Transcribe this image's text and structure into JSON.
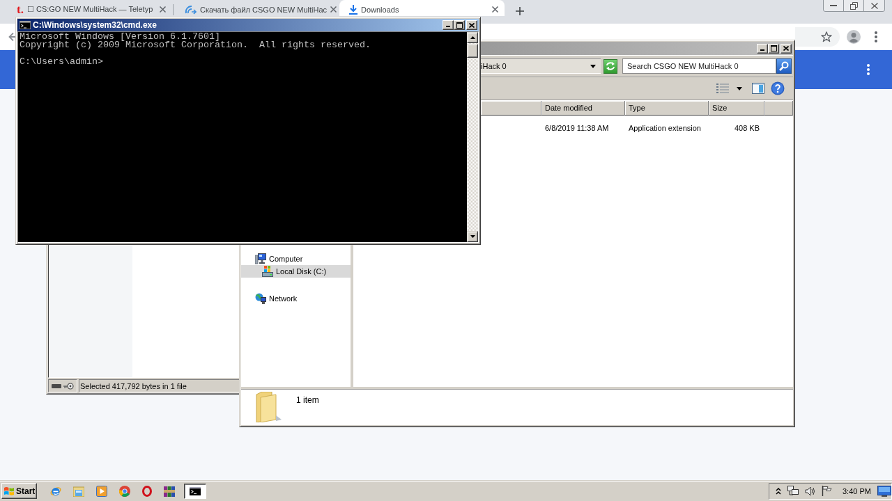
{
  "browser": {
    "tabs": [
      {
        "kind": "letter",
        "favicon_text": "t.",
        "title": "☐ CS:GO NEW MultiHack — Teletyp",
        "selected": false
      },
      {
        "kind": "arcs",
        "title": "Скачать файл CSGO NEW MultiHac",
        "selected": false
      },
      {
        "kind": "download",
        "title": "Downloads",
        "selected": true
      }
    ]
  },
  "back_window": {
    "status_text": "Selected 417,792 bytes in 1 file"
  },
  "explorer_window": {
    "active": false,
    "address": "iHack 0",
    "search": {
      "placeholder": "Search CSGO NEW MultiHack 0"
    },
    "nav": [
      {
        "kind": "computer",
        "label": "Computer",
        "selected": false,
        "children": [
          {
            "kind": "disk",
            "label": "Local Disk (C:)",
            "selected": true
          }
        ]
      },
      {
        "kind": "network",
        "label": "Network",
        "selected": false
      }
    ],
    "columns": [
      {
        "label": "Date modified"
      },
      {
        "label": "Type"
      },
      {
        "label": "Size"
      }
    ],
    "rows": [
      {
        "cells": [
          "6/8/2019 11:38 AM",
          "Application extension",
          "408 KB"
        ]
      }
    ],
    "details": {
      "summary": "1 item"
    }
  },
  "cmd_window": {
    "title": "C:\\Windows\\system32\\cmd.exe",
    "active": true,
    "output": [
      "Microsoft Windows [Version 6.1.7601]",
      "Copyright (c) 2009 Microsoft Corporation.  All rights reserved."
    ],
    "prompt": "C:\\Users\\admin>"
  },
  "taskbar": {
    "start_label": "Start",
    "quick_launch": [
      {
        "kind": "e_globe"
      },
      {
        "kind": "folder"
      },
      {
        "kind": "play"
      },
      {
        "kind": "circle"
      },
      {
        "kind": "ring"
      },
      {
        "kind": "books"
      }
    ],
    "tasks": [
      {
        "kind": "terminal",
        "active": true
      }
    ],
    "clock": "3:40 PM"
  }
}
